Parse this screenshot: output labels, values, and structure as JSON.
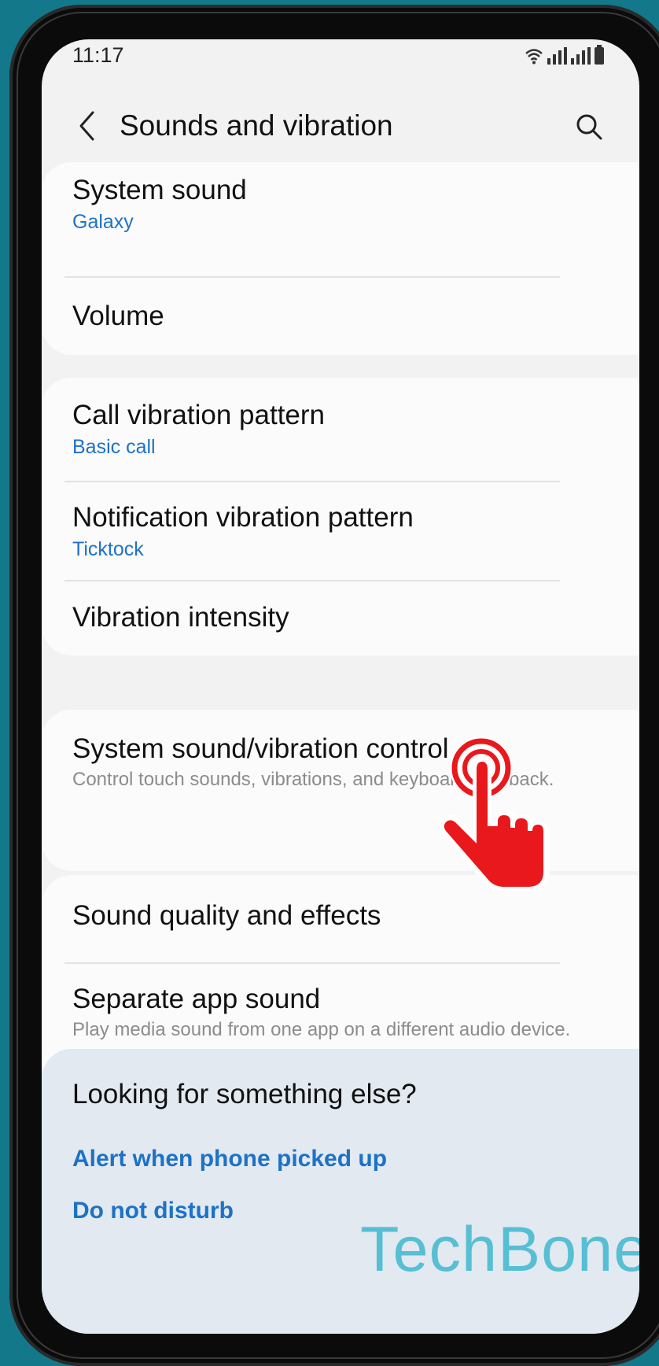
{
  "status": {
    "time": "11:17"
  },
  "header": {
    "title": "Sounds and vibration"
  },
  "group1": {
    "system_sound": {
      "title": "System sound",
      "value": "Galaxy"
    },
    "volume": {
      "title": "Volume"
    }
  },
  "group2": {
    "call_vibration": {
      "title": "Call vibration pattern",
      "value": "Basic call"
    },
    "notification_vibration": {
      "title": "Notification vibration pattern",
      "value": "Ticktock"
    },
    "vibration_intensity": {
      "title": "Vibration intensity"
    }
  },
  "group3": {
    "control": {
      "title": "System sound/vibration control",
      "desc": "Control touch sounds, vibrations, and keyboard feedback."
    }
  },
  "group4": {
    "quality": {
      "title": "Sound quality and effects"
    },
    "separate": {
      "title": "Separate app sound",
      "desc": "Play media sound from one app on a different audio device."
    }
  },
  "suggest": {
    "title": "Looking for something else?",
    "links": [
      "Alert when phone picked up",
      "Do not disturb"
    ]
  },
  "watermark": "TechBone",
  "colors": {
    "accent": "#1d72c6",
    "background": "#12788a",
    "hand": "#e8181d"
  },
  "icons": [
    "back-arrow-icon",
    "search-icon",
    "wifi-icon",
    "signal-icon",
    "battery-icon",
    "tap-hand-icon"
  ]
}
